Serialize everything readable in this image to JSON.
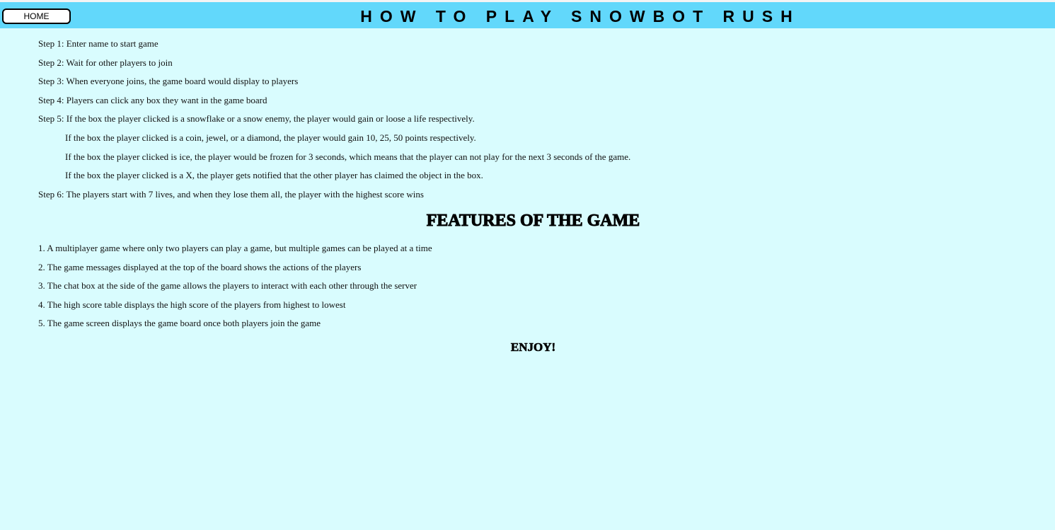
{
  "header": {
    "home_label": "HOME",
    "title": "HOW TO PLAY SNOWBOT RUSH"
  },
  "steps": [
    "Step 1: Enter name to start game",
    "Step 2: Wait for other players to join",
    "Step 3: When everyone joins, the game board would display to players",
    "Step 4: Players can click any box they want in the game board",
    "Step 5: If the box the player clicked is a snowflake or a snow enemy, the player would gain or loose a life respectively.",
    "If the box the player clicked is a coin, jewel, or a diamond, the player would gain 10, 25, 50 points respectively.",
    "If the box the player clicked is ice, the player would be frozen for 3 seconds, which means that the player can not play for the next 3 seconds of the game.",
    "If the box the player clicked is a X, the player gets notified that the other player has claimed the object in the box.",
    "Step 6: The players start with 7 lives, and when they lose them all, the player with the highest score wins"
  ],
  "features_heading": "FEATURES OF THE GAME",
  "features": [
    "1. A multiplayer game where only two players can play a game, but multiple games can be played at a time",
    "2. The game messages displayed at the top of the board shows the actions of the players",
    "3. The chat box at the side of the game allows the players to interact with each other through the server",
    "4. The high score table displays the high score of the players from highest to lowest",
    "5. The game screen displays the game board once both players join the game"
  ],
  "closing": "ENJOY!",
  "colors": {
    "header_background": "#62d8fb",
    "page_background": "#d9fcfe"
  }
}
